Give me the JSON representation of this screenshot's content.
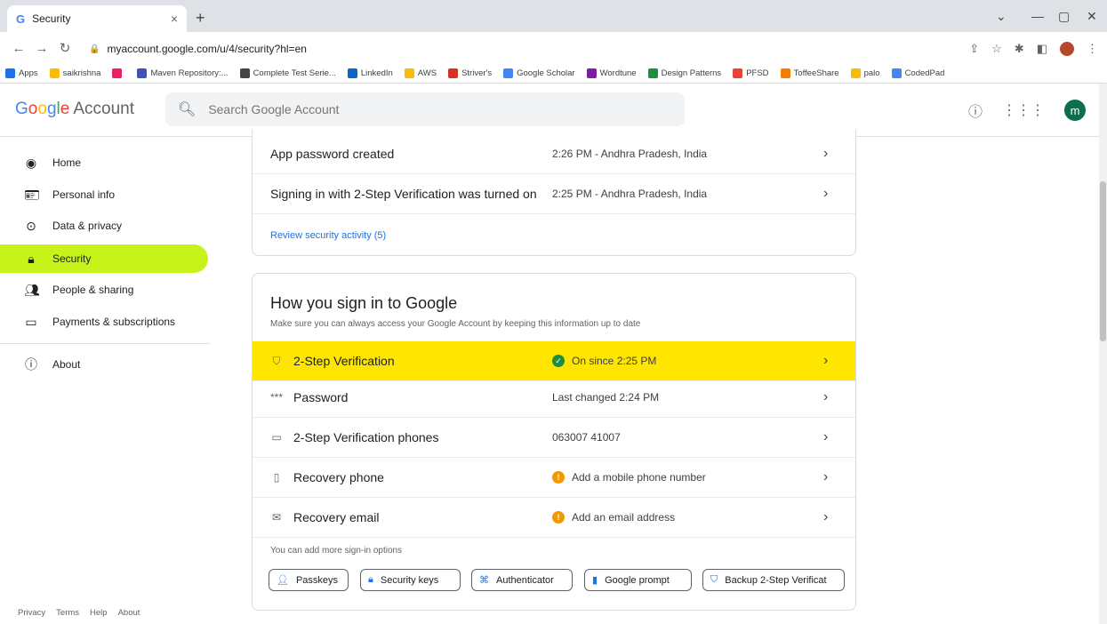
{
  "browser": {
    "tab_title": "Security",
    "tab_close": "×",
    "new_tab": "+",
    "url": "myaccount.google.com/u/4/security?hl=en",
    "bookmarks": [
      {
        "label": "Apps",
        "color": "#1a73e8"
      },
      {
        "label": "saikrishna",
        "color": "#fbbc04"
      },
      {
        "label": "",
        "color": "#e91e63"
      },
      {
        "label": "Maven Repository:...",
        "color": "#3f51b5"
      },
      {
        "label": "Complete Test Serie...",
        "color": "#444444"
      },
      {
        "label": "LinkedIn",
        "color": "#0a66c2"
      },
      {
        "label": "AWS",
        "color": "#fbbc04"
      },
      {
        "label": "Striver's",
        "color": "#d93025"
      },
      {
        "label": "Google Scholar",
        "color": "#4285f4"
      },
      {
        "label": "Wordtune",
        "color": "#7b1fa2"
      },
      {
        "label": "Design Patterns",
        "color": "#1e8e3e"
      },
      {
        "label": "PFSD",
        "color": "#ea4335"
      },
      {
        "label": "ToffeeShare",
        "color": "#f57c00"
      },
      {
        "label": "palo",
        "color": "#fbbc04"
      },
      {
        "label": "CodedPad",
        "color": "#4285f4"
      }
    ]
  },
  "header": {
    "logo": "Google",
    "logo_suffix": "Account",
    "search_placeholder": "Search Google Account",
    "avatar_letter": "m"
  },
  "sidebar": {
    "items": [
      {
        "label": "Home",
        "icon": "home-icon"
      },
      {
        "label": "Personal info",
        "icon": "id-card-icon"
      },
      {
        "label": "Data & privacy",
        "icon": "toggle-icon"
      },
      {
        "label": "Security",
        "icon": "lock-icon"
      },
      {
        "label": "People & sharing",
        "icon": "people-icon"
      },
      {
        "label": "Payments & subscriptions",
        "icon": "card-icon"
      },
      {
        "label": "About",
        "icon": "info-icon"
      }
    ],
    "active": "Security",
    "footer": [
      "Privacy",
      "Terms",
      "Help",
      "About"
    ]
  },
  "activity": {
    "rows": [
      {
        "title": "App password created",
        "value": "2:26 PM - Andhra Pradesh, India"
      },
      {
        "title": "Signing in with 2-Step Verification was turned on",
        "value": "2:25 PM - Andhra Pradesh, India"
      }
    ],
    "review_link": "Review security activity (5)"
  },
  "signin": {
    "title": "How you sign in to Google",
    "subtitle": "Make sure you can always access your Google Account by keeping this information up to date",
    "rows": [
      {
        "title": "2-Step Verification",
        "value": "On since 2:25 PM",
        "status": "ok",
        "icon": "shield-icon"
      },
      {
        "title": "Password",
        "value": "Last changed 2:24 PM",
        "status": "",
        "icon": "password-icon"
      },
      {
        "title": "2-Step Verification phones",
        "value": "063007 41007",
        "status": "",
        "icon": "message-icon"
      },
      {
        "title": "Recovery phone",
        "value": "Add a mobile phone number",
        "status": "warn",
        "icon": "phone-icon"
      },
      {
        "title": "Recovery email",
        "value": "Add an email address",
        "status": "warn",
        "icon": "mail-icon"
      }
    ],
    "more_options": "You can add more sign-in options",
    "chips": [
      "Passkeys",
      "Security keys",
      "Authenticator",
      "Google prompt",
      "Backup 2-Step Verificat"
    ]
  }
}
